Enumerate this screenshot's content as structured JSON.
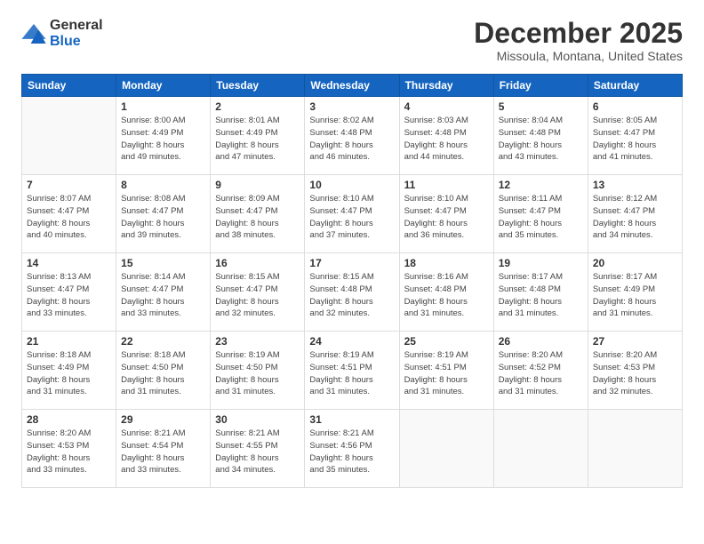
{
  "logo": {
    "line1": "General",
    "line2": "Blue"
  },
  "title": "December 2025",
  "subtitle": "Missoula, Montana, United States",
  "weekdays": [
    "Sunday",
    "Monday",
    "Tuesday",
    "Wednesday",
    "Thursday",
    "Friday",
    "Saturday"
  ],
  "weeks": [
    [
      {
        "day": "",
        "info": ""
      },
      {
        "day": "1",
        "info": "Sunrise: 8:00 AM\nSunset: 4:49 PM\nDaylight: 8 hours\nand 49 minutes."
      },
      {
        "day": "2",
        "info": "Sunrise: 8:01 AM\nSunset: 4:49 PM\nDaylight: 8 hours\nand 47 minutes."
      },
      {
        "day": "3",
        "info": "Sunrise: 8:02 AM\nSunset: 4:48 PM\nDaylight: 8 hours\nand 46 minutes."
      },
      {
        "day": "4",
        "info": "Sunrise: 8:03 AM\nSunset: 4:48 PM\nDaylight: 8 hours\nand 44 minutes."
      },
      {
        "day": "5",
        "info": "Sunrise: 8:04 AM\nSunset: 4:48 PM\nDaylight: 8 hours\nand 43 minutes."
      },
      {
        "day": "6",
        "info": "Sunrise: 8:05 AM\nSunset: 4:47 PM\nDaylight: 8 hours\nand 41 minutes."
      }
    ],
    [
      {
        "day": "7",
        "info": "Sunrise: 8:07 AM\nSunset: 4:47 PM\nDaylight: 8 hours\nand 40 minutes."
      },
      {
        "day": "8",
        "info": "Sunrise: 8:08 AM\nSunset: 4:47 PM\nDaylight: 8 hours\nand 39 minutes."
      },
      {
        "day": "9",
        "info": "Sunrise: 8:09 AM\nSunset: 4:47 PM\nDaylight: 8 hours\nand 38 minutes."
      },
      {
        "day": "10",
        "info": "Sunrise: 8:10 AM\nSunset: 4:47 PM\nDaylight: 8 hours\nand 37 minutes."
      },
      {
        "day": "11",
        "info": "Sunrise: 8:10 AM\nSunset: 4:47 PM\nDaylight: 8 hours\nand 36 minutes."
      },
      {
        "day": "12",
        "info": "Sunrise: 8:11 AM\nSunset: 4:47 PM\nDaylight: 8 hours\nand 35 minutes."
      },
      {
        "day": "13",
        "info": "Sunrise: 8:12 AM\nSunset: 4:47 PM\nDaylight: 8 hours\nand 34 minutes."
      }
    ],
    [
      {
        "day": "14",
        "info": "Sunrise: 8:13 AM\nSunset: 4:47 PM\nDaylight: 8 hours\nand 33 minutes."
      },
      {
        "day": "15",
        "info": "Sunrise: 8:14 AM\nSunset: 4:47 PM\nDaylight: 8 hours\nand 33 minutes."
      },
      {
        "day": "16",
        "info": "Sunrise: 8:15 AM\nSunset: 4:47 PM\nDaylight: 8 hours\nand 32 minutes."
      },
      {
        "day": "17",
        "info": "Sunrise: 8:15 AM\nSunset: 4:48 PM\nDaylight: 8 hours\nand 32 minutes."
      },
      {
        "day": "18",
        "info": "Sunrise: 8:16 AM\nSunset: 4:48 PM\nDaylight: 8 hours\nand 31 minutes."
      },
      {
        "day": "19",
        "info": "Sunrise: 8:17 AM\nSunset: 4:48 PM\nDaylight: 8 hours\nand 31 minutes."
      },
      {
        "day": "20",
        "info": "Sunrise: 8:17 AM\nSunset: 4:49 PM\nDaylight: 8 hours\nand 31 minutes."
      }
    ],
    [
      {
        "day": "21",
        "info": "Sunrise: 8:18 AM\nSunset: 4:49 PM\nDaylight: 8 hours\nand 31 minutes."
      },
      {
        "day": "22",
        "info": "Sunrise: 8:18 AM\nSunset: 4:50 PM\nDaylight: 8 hours\nand 31 minutes."
      },
      {
        "day": "23",
        "info": "Sunrise: 8:19 AM\nSunset: 4:50 PM\nDaylight: 8 hours\nand 31 minutes."
      },
      {
        "day": "24",
        "info": "Sunrise: 8:19 AM\nSunset: 4:51 PM\nDaylight: 8 hours\nand 31 minutes."
      },
      {
        "day": "25",
        "info": "Sunrise: 8:19 AM\nSunset: 4:51 PM\nDaylight: 8 hours\nand 31 minutes."
      },
      {
        "day": "26",
        "info": "Sunrise: 8:20 AM\nSunset: 4:52 PM\nDaylight: 8 hours\nand 31 minutes."
      },
      {
        "day": "27",
        "info": "Sunrise: 8:20 AM\nSunset: 4:53 PM\nDaylight: 8 hours\nand 32 minutes."
      }
    ],
    [
      {
        "day": "28",
        "info": "Sunrise: 8:20 AM\nSunset: 4:53 PM\nDaylight: 8 hours\nand 33 minutes."
      },
      {
        "day": "29",
        "info": "Sunrise: 8:21 AM\nSunset: 4:54 PM\nDaylight: 8 hours\nand 33 minutes."
      },
      {
        "day": "30",
        "info": "Sunrise: 8:21 AM\nSunset: 4:55 PM\nDaylight: 8 hours\nand 34 minutes."
      },
      {
        "day": "31",
        "info": "Sunrise: 8:21 AM\nSunset: 4:56 PM\nDaylight: 8 hours\nand 35 minutes."
      },
      {
        "day": "",
        "info": ""
      },
      {
        "day": "",
        "info": ""
      },
      {
        "day": "",
        "info": ""
      }
    ]
  ]
}
